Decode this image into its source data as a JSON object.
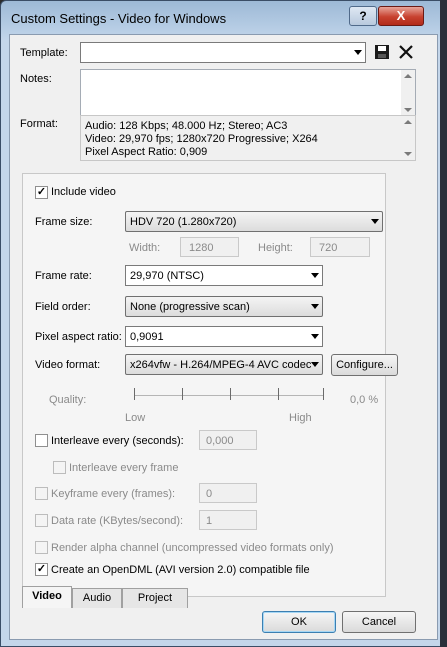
{
  "window": {
    "title": "Custom Settings - Video for Windows",
    "help_label": "?",
    "close_label": "X"
  },
  "template": {
    "label": "Template:",
    "value": "",
    "save_icon": "save-icon",
    "delete_icon": "delete-x-icon"
  },
  "notes": {
    "label": "Notes:",
    "value": ""
  },
  "format": {
    "label": "Format:",
    "lines": [
      "Audio: 128 Kbps; 48.000 Hz; Stereo; AC3",
      "Video: 29,970 fps; 1280x720 Progressive; X264",
      "Pixel Aspect Ratio: 0,909"
    ]
  },
  "video": {
    "include_video_label": "Include video",
    "include_video_checked": true,
    "frame_size": {
      "label": "Frame size:",
      "value": "HDV 720 (1.280x720)"
    },
    "width": {
      "label": "Width:",
      "value": "1280"
    },
    "height": {
      "label": "Height:",
      "value": "720"
    },
    "frame_rate": {
      "label": "Frame rate:",
      "value": "29,970 (NTSC)"
    },
    "field_order": {
      "label": "Field order:",
      "value": "None (progressive scan)"
    },
    "pixel_aspect": {
      "label": "Pixel aspect ratio:",
      "value": "0,9091"
    },
    "video_format": {
      "label": "Video format:",
      "value": "x264vfw - H.264/MPEG-4 AVC codec"
    },
    "configure_label": "Configure...",
    "quality": {
      "label": "Quality:",
      "low": "Low",
      "high": "High",
      "value_text": "0,0 %"
    },
    "interleave_seconds": {
      "label": "Interleave every (seconds):",
      "value": "0,000",
      "checked": false
    },
    "interleave_frame": {
      "label": "Interleave every frame",
      "checked": false
    },
    "keyframe": {
      "label": "Keyframe every (frames):",
      "value": "0",
      "checked": false
    },
    "data_rate": {
      "label": "Data rate (KBytes/second):",
      "value": "1",
      "checked": false
    },
    "render_alpha": {
      "label": "Render alpha channel (uncompressed video formats only)",
      "checked": false
    },
    "opendml": {
      "label": "Create an OpenDML (AVI version 2.0) compatible file",
      "checked": true
    }
  },
  "tabs": [
    {
      "label": "Video",
      "active": true
    },
    {
      "label": "Audio",
      "active": false
    },
    {
      "label": "Project",
      "active": false
    }
  ],
  "buttons": {
    "ok": "OK",
    "cancel": "Cancel"
  },
  "check_mark": "✓"
}
